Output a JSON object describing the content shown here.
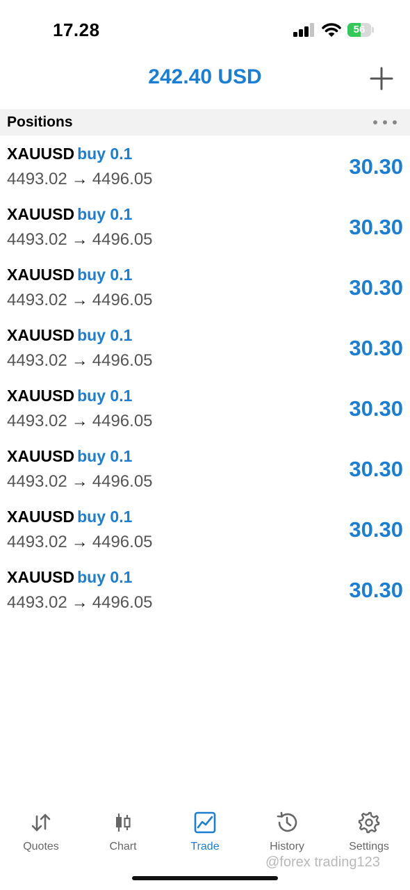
{
  "status_bar": {
    "time": "17.28",
    "battery_level": "56",
    "battery_fraction": 0.56
  },
  "header": {
    "balance": "242.40 USD",
    "add_icon": "plus-icon"
  },
  "section": {
    "title": "Positions",
    "more_icon": "ellipsis-icon"
  },
  "positions": [
    {
      "symbol": "XAUUSD",
      "direction": "buy 0.1",
      "open_price": "4493.02",
      "arrow": "→",
      "current_price": "4496.05",
      "profit": "30.30"
    },
    {
      "symbol": "XAUUSD",
      "direction": "buy 0.1",
      "open_price": "4493.02",
      "arrow": "→",
      "current_price": "4496.05",
      "profit": "30.30"
    },
    {
      "symbol": "XAUUSD",
      "direction": "buy 0.1",
      "open_price": "4493.02",
      "arrow": "→",
      "current_price": "4496.05",
      "profit": "30.30"
    },
    {
      "symbol": "XAUUSD",
      "direction": "buy 0.1",
      "open_price": "4493.02",
      "arrow": "→",
      "current_price": "4496.05",
      "profit": "30.30"
    },
    {
      "symbol": "XAUUSD",
      "direction": "buy 0.1",
      "open_price": "4493.02",
      "arrow": "→",
      "current_price": "4496.05",
      "profit": "30.30"
    },
    {
      "symbol": "XAUUSD",
      "direction": "buy 0.1",
      "open_price": "4493.02",
      "arrow": "→",
      "current_price": "4496.05",
      "profit": "30.30"
    },
    {
      "symbol": "XAUUSD",
      "direction": "buy 0.1",
      "open_price": "4493.02",
      "arrow": "→",
      "current_price": "4496.05",
      "profit": "30.30"
    },
    {
      "symbol": "XAUUSD",
      "direction": "buy 0.1",
      "open_price": "4493.02",
      "arrow": "→",
      "current_price": "4496.05",
      "profit": "30.30"
    }
  ],
  "tabs": [
    {
      "label": "Quotes",
      "icon": "quotes-arrows-icon",
      "active": false
    },
    {
      "label": "Chart",
      "icon": "candlestick-icon",
      "active": false
    },
    {
      "label": "Trade",
      "icon": "trade-chart-icon",
      "active": true
    },
    {
      "label": "History",
      "icon": "history-clock-icon",
      "active": false
    },
    {
      "label": "Settings",
      "icon": "gear-icon",
      "active": false
    }
  ],
  "watermark": "@forex trading123",
  "colors": {
    "accent": "#1a7fd4",
    "section_bg": "#f2f2f2",
    "battery": "#34c759"
  }
}
